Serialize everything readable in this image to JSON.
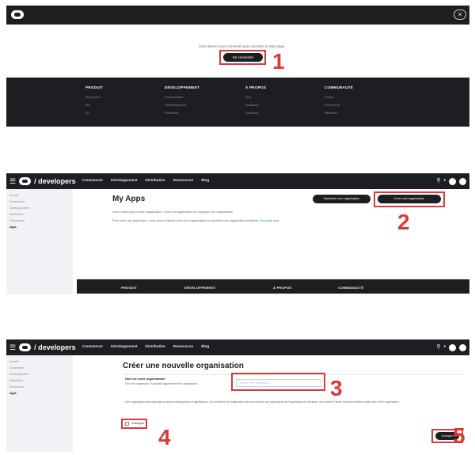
{
  "panel1": {
    "message": "Vous devez vous connecter pour accéder à cette page",
    "login_button": "Se connecter",
    "step": "1",
    "footer": [
      {
        "heading": "PRODUIT",
        "items": [
          "Meta Quest",
          "Rift",
          "Go"
        ]
      },
      {
        "heading": "DÉVELOPPEMENT",
        "items": [
          "Documentation",
          "Téléchargements",
          "Distribution"
        ]
      },
      {
        "heading": "À PROPOS",
        "items": [
          "Blog",
          "Assistance",
          "Conditions"
        ]
      },
      {
        "heading": "COMMUNAUTÉ",
        "items": [
          "Forums",
          "Événements",
          "Newsletter"
        ]
      }
    ]
  },
  "header": {
    "brand": "developers",
    "nav": [
      "Commencer",
      "Développement",
      "Distribution",
      "Ressources",
      "Blog"
    ],
    "search_icon": "search-icon",
    "notification_icon": "bell-icon"
  },
  "sidebar_items": [
    "Accueil",
    "Commencer",
    "Développement",
    "Distribution",
    "Ressources",
    "Apps"
  ],
  "panel2": {
    "title": "My Apps",
    "paragraph1": "Vous n'avez pas encore d'application. Créez une application ou rejoignez une organisation.",
    "paragraph2": "Pour créer une application, vous devez d'abord créer une organisation ou rejoindre une organisation existante.",
    "link_text": "En savoir plus",
    "button_join": "Rejoindre une organisation",
    "button_create": "Créer une organisation",
    "step": "2",
    "footer_heads": [
      "PRODUIT",
      "DÉVELOPPEMENT",
      "À PROPOS",
      "COMMUNAUTÉ"
    ]
  },
  "panel3": {
    "title": "Créer une nouvelle organisation",
    "name_label": "Nom de votre organisation",
    "name_hint": "Nom de l'organisation à laquelle appartiennent les applications",
    "input_placeholder": "Nom de votre organisation",
    "description": "Une organisation peut regrouper plusieurs développeurs et applications. Les membres de l'organisation peuvent accéder aux applications de l'organisation et les gérer. Vous pourrez inviter d'autres membres après avoir créé l'organisation.",
    "checkbox_label": "J'accepte",
    "create_button": "Envoyer",
    "step_input": "3",
    "step_checkbox": "4",
    "step_submit": "5"
  },
  "colors": {
    "dark": "#1c1e21",
    "annotation_red": "#d93a3a",
    "sidebar_bg": "#f0f2f5",
    "link_blue": "#1877f2"
  }
}
